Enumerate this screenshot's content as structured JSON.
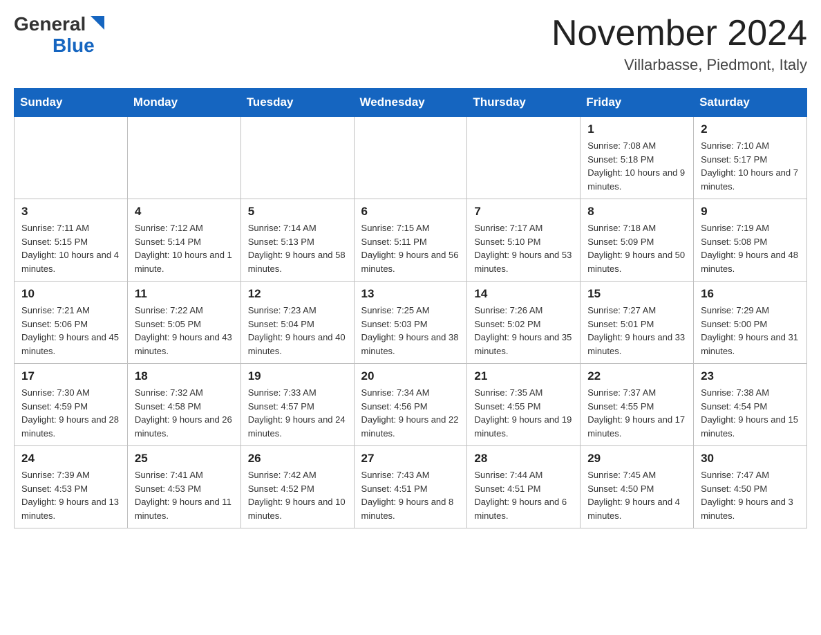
{
  "header": {
    "logo_line1": "General",
    "logo_line2": "Blue",
    "month_title": "November 2024",
    "location": "Villarbasse, Piedmont, Italy"
  },
  "days_of_week": [
    "Sunday",
    "Monday",
    "Tuesday",
    "Wednesday",
    "Thursday",
    "Friday",
    "Saturday"
  ],
  "weeks": [
    [
      {
        "day": "",
        "info": ""
      },
      {
        "day": "",
        "info": ""
      },
      {
        "day": "",
        "info": ""
      },
      {
        "day": "",
        "info": ""
      },
      {
        "day": "",
        "info": ""
      },
      {
        "day": "1",
        "info": "Sunrise: 7:08 AM\nSunset: 5:18 PM\nDaylight: 10 hours and 9 minutes."
      },
      {
        "day": "2",
        "info": "Sunrise: 7:10 AM\nSunset: 5:17 PM\nDaylight: 10 hours and 7 minutes."
      }
    ],
    [
      {
        "day": "3",
        "info": "Sunrise: 7:11 AM\nSunset: 5:15 PM\nDaylight: 10 hours and 4 minutes."
      },
      {
        "day": "4",
        "info": "Sunrise: 7:12 AM\nSunset: 5:14 PM\nDaylight: 10 hours and 1 minute."
      },
      {
        "day": "5",
        "info": "Sunrise: 7:14 AM\nSunset: 5:13 PM\nDaylight: 9 hours and 58 minutes."
      },
      {
        "day": "6",
        "info": "Sunrise: 7:15 AM\nSunset: 5:11 PM\nDaylight: 9 hours and 56 minutes."
      },
      {
        "day": "7",
        "info": "Sunrise: 7:17 AM\nSunset: 5:10 PM\nDaylight: 9 hours and 53 minutes."
      },
      {
        "day": "8",
        "info": "Sunrise: 7:18 AM\nSunset: 5:09 PM\nDaylight: 9 hours and 50 minutes."
      },
      {
        "day": "9",
        "info": "Sunrise: 7:19 AM\nSunset: 5:08 PM\nDaylight: 9 hours and 48 minutes."
      }
    ],
    [
      {
        "day": "10",
        "info": "Sunrise: 7:21 AM\nSunset: 5:06 PM\nDaylight: 9 hours and 45 minutes."
      },
      {
        "day": "11",
        "info": "Sunrise: 7:22 AM\nSunset: 5:05 PM\nDaylight: 9 hours and 43 minutes."
      },
      {
        "day": "12",
        "info": "Sunrise: 7:23 AM\nSunset: 5:04 PM\nDaylight: 9 hours and 40 minutes."
      },
      {
        "day": "13",
        "info": "Sunrise: 7:25 AM\nSunset: 5:03 PM\nDaylight: 9 hours and 38 minutes."
      },
      {
        "day": "14",
        "info": "Sunrise: 7:26 AM\nSunset: 5:02 PM\nDaylight: 9 hours and 35 minutes."
      },
      {
        "day": "15",
        "info": "Sunrise: 7:27 AM\nSunset: 5:01 PM\nDaylight: 9 hours and 33 minutes."
      },
      {
        "day": "16",
        "info": "Sunrise: 7:29 AM\nSunset: 5:00 PM\nDaylight: 9 hours and 31 minutes."
      }
    ],
    [
      {
        "day": "17",
        "info": "Sunrise: 7:30 AM\nSunset: 4:59 PM\nDaylight: 9 hours and 28 minutes."
      },
      {
        "day": "18",
        "info": "Sunrise: 7:32 AM\nSunset: 4:58 PM\nDaylight: 9 hours and 26 minutes."
      },
      {
        "day": "19",
        "info": "Sunrise: 7:33 AM\nSunset: 4:57 PM\nDaylight: 9 hours and 24 minutes."
      },
      {
        "day": "20",
        "info": "Sunrise: 7:34 AM\nSunset: 4:56 PM\nDaylight: 9 hours and 22 minutes."
      },
      {
        "day": "21",
        "info": "Sunrise: 7:35 AM\nSunset: 4:55 PM\nDaylight: 9 hours and 19 minutes."
      },
      {
        "day": "22",
        "info": "Sunrise: 7:37 AM\nSunset: 4:55 PM\nDaylight: 9 hours and 17 minutes."
      },
      {
        "day": "23",
        "info": "Sunrise: 7:38 AM\nSunset: 4:54 PM\nDaylight: 9 hours and 15 minutes."
      }
    ],
    [
      {
        "day": "24",
        "info": "Sunrise: 7:39 AM\nSunset: 4:53 PM\nDaylight: 9 hours and 13 minutes."
      },
      {
        "day": "25",
        "info": "Sunrise: 7:41 AM\nSunset: 4:53 PM\nDaylight: 9 hours and 11 minutes."
      },
      {
        "day": "26",
        "info": "Sunrise: 7:42 AM\nSunset: 4:52 PM\nDaylight: 9 hours and 10 minutes."
      },
      {
        "day": "27",
        "info": "Sunrise: 7:43 AM\nSunset: 4:51 PM\nDaylight: 9 hours and 8 minutes."
      },
      {
        "day": "28",
        "info": "Sunrise: 7:44 AM\nSunset: 4:51 PM\nDaylight: 9 hours and 6 minutes."
      },
      {
        "day": "29",
        "info": "Sunrise: 7:45 AM\nSunset: 4:50 PM\nDaylight: 9 hours and 4 minutes."
      },
      {
        "day": "30",
        "info": "Sunrise: 7:47 AM\nSunset: 4:50 PM\nDaylight: 9 hours and 3 minutes."
      }
    ]
  ]
}
